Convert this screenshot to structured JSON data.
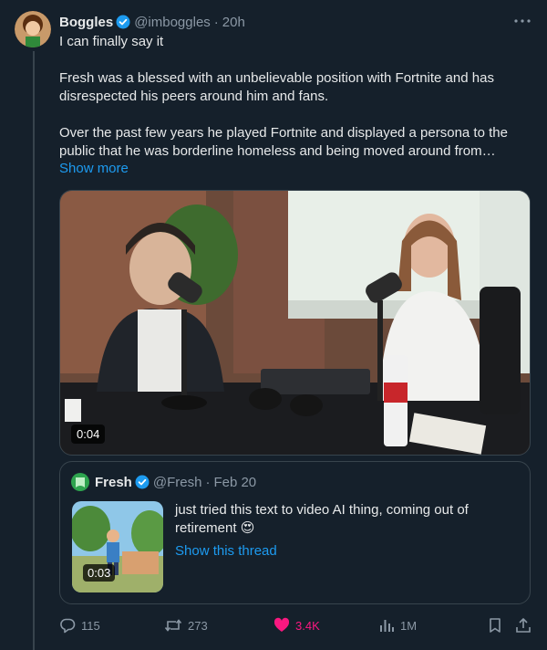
{
  "tweet": {
    "author_name": "Boggles",
    "author_handle": "@imboggles",
    "time": "20h",
    "paragraphs": [
      "I can finally say it",
      "Fresh was a blessed with an unbelievable position with Fortnite and has disrespected his peers around him and fans.",
      "Over the past few years he played Fortnite and displayed a persona to the public that he was borderline homeless and being moved around from…"
    ],
    "show_more": "Show more",
    "video_duration": "0:04"
  },
  "quote": {
    "author_name": "Fresh",
    "author_handle": "@Fresh",
    "date": "Feb 20",
    "text": "just tried this text to video AI thing, coming out of retirement 😍",
    "show_thread": "Show this thread",
    "video_duration": "0:03"
  },
  "actions": {
    "replies": "115",
    "retweets": "273",
    "likes": "3.4K",
    "views": "1M"
  },
  "colors": {
    "background": "#15202b",
    "link": "#1d9bf0",
    "like": "#f91880",
    "muted": "#8b98a5"
  }
}
